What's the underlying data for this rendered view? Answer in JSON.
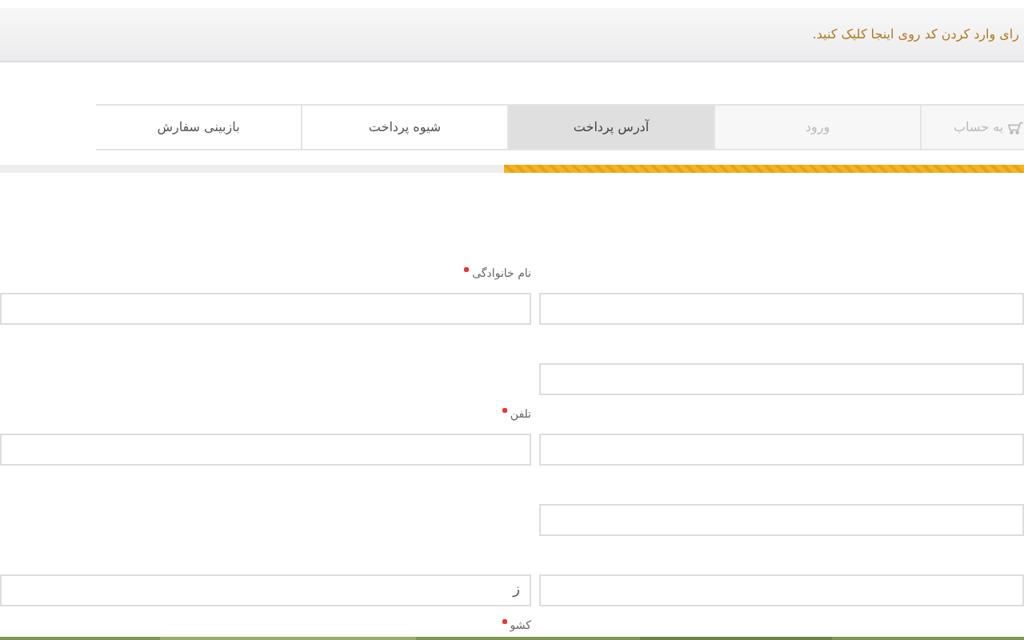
{
  "notice": {
    "text": "رای وارد کردن کد روی اینجا کلیک کنید."
  },
  "steps": [
    {
      "label": "یه حساب",
      "selected": false,
      "disabled": true,
      "icon": true
    },
    {
      "label": "ورود",
      "selected": false,
      "disabled": true,
      "icon": false
    },
    {
      "label": "آدرس پرداخت",
      "selected": true,
      "disabled": false,
      "icon": false
    },
    {
      "label": "شیوه پرداخت",
      "selected": false,
      "disabled": false,
      "icon": false
    },
    {
      "label": "بازبینی سفارش",
      "selected": false,
      "disabled": false,
      "icon": false
    }
  ],
  "progress": {
    "level": 0.508
  },
  "form_rows": [
    {
      "kind": "label",
      "text": "نام خانوادگی",
      "required": true
    },
    {
      "kind": "inputs",
      "left": true,
      "left_value": ""
    },
    {
      "kind": "inputs",
      "left": false
    },
    {
      "kind": "label",
      "text": "تلفن",
      "required": true
    },
    {
      "kind": "inputs",
      "left": true,
      "left_value": ""
    },
    {
      "kind": "inputs",
      "left": false
    },
    {
      "kind": "inputs",
      "left": true,
      "left_value": "ز"
    },
    {
      "kind": "label",
      "text": "کشو",
      "required": true
    }
  ]
}
